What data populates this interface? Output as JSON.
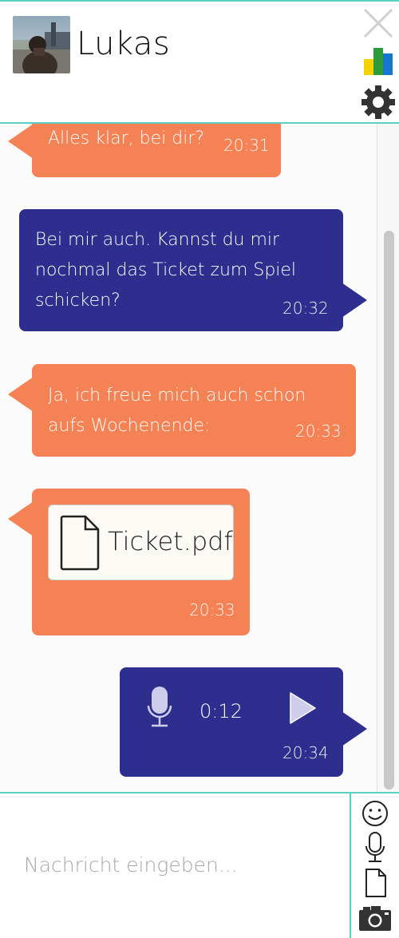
{
  "header": {
    "contact_name": "Lukas",
    "avatar": "avatar-photo",
    "icons": {
      "close": "close-icon",
      "stats": "bar-chart-icon",
      "settings": "gear-icon"
    }
  },
  "messages": [
    {
      "direction": "in",
      "text": "Alles klar, bei dir?",
      "time": "20:31"
    },
    {
      "direction": "out",
      "lines": [
        "Bei mir auch. Kannst du mir",
        "nochmal das Ticket zum Spiel",
        "schicken?"
      ],
      "time": "20:32"
    },
    {
      "direction": "in",
      "lines": [
        "Ja, ich freue mich auch schon",
        "aufs Wochenende:"
      ],
      "time": "20:33"
    },
    {
      "direction": "in",
      "type": "file",
      "file_name": "Ticket.pdf",
      "time": "20:33"
    },
    {
      "direction": "out",
      "type": "voice",
      "duration": "0:12",
      "time": "20:34"
    }
  ],
  "composer": {
    "placeholder": "Nachricht eingeben...",
    "actions": [
      "emoji-icon",
      "microphone-icon",
      "document-icon",
      "camera-icon"
    ]
  },
  "colors": {
    "accent": "#5ccfc4",
    "incoming": "#f58255",
    "outgoing": "#2d2e8d"
  }
}
